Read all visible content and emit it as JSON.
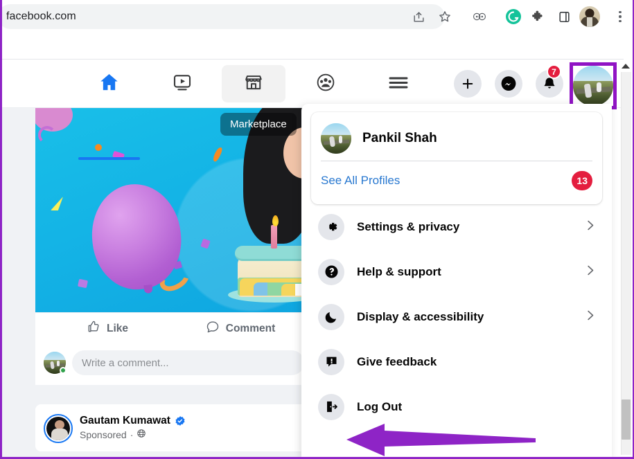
{
  "browser": {
    "url": "facebook.com",
    "icons": [
      {
        "name": "share-icon"
      },
      {
        "name": "bookmark-star-icon"
      },
      {
        "name": "profiles-icon"
      },
      {
        "name": "grammarly-extension-icon"
      },
      {
        "name": "extensions-puzzle-icon"
      },
      {
        "name": "side-panel-icon"
      },
      {
        "name": "browser-profile-avatar"
      },
      {
        "name": "chrome-menu-kebab-icon"
      }
    ],
    "accent_green": "#15c39a"
  },
  "fb_nav": {
    "tabs": [
      {
        "label": "Home",
        "icon": "home-icon",
        "active": true
      },
      {
        "label": "Video",
        "icon": "video-icon",
        "active": false
      },
      {
        "label": "Marketplace",
        "icon": "marketplace-store-icon",
        "active": false
      },
      {
        "label": "Groups",
        "icon": "groups-icon",
        "active": false
      },
      {
        "label": "Menu",
        "icon": "hamburger-menu-icon",
        "active": false
      }
    ],
    "actions": [
      {
        "label": "Create",
        "icon": "plus-icon"
      },
      {
        "label": "Messenger",
        "icon": "messenger-icon"
      },
      {
        "label": "Notifications",
        "icon": "bell-icon",
        "badge": "7"
      }
    ],
    "account_avatar": "account-avatar",
    "active_color": "#1877f2",
    "badge_color": "#e41e3f",
    "highlight_color": "#9013c4"
  },
  "feed": {
    "post": {
      "image_tooltip": "Marketplace",
      "like_label": "Like",
      "comment_label": "Comment",
      "comment_placeholder": "Write a comment..."
    },
    "sponsored_post": {
      "name": "Gautam Kumawat",
      "meta": "Sponsored",
      "meta_separator": "·",
      "audience_icon": "globe-icon",
      "verified": true,
      "verified_color": "#1877f2"
    }
  },
  "dropdown": {
    "profile": {
      "name": "Pankil Shah",
      "see_all_label": "See All Profiles",
      "see_all_badge": "13"
    },
    "items": [
      {
        "label": "Settings & privacy",
        "icon": "gear-icon",
        "chevron": true
      },
      {
        "label": "Help & support",
        "icon": "question-circle-icon",
        "chevron": true
      },
      {
        "label": "Display & accessibility",
        "icon": "moon-icon",
        "chevron": true
      },
      {
        "label": "Give feedback",
        "icon": "feedback-bubble-icon",
        "chevron": false
      },
      {
        "label": "Log Out",
        "icon": "logout-door-icon",
        "chevron": false
      }
    ]
  },
  "annotation": {
    "arrow_color": "#8e24c6",
    "points_at": "Log Out"
  },
  "scrollbar": {
    "up_arrow": "scroll-up-arrow"
  }
}
